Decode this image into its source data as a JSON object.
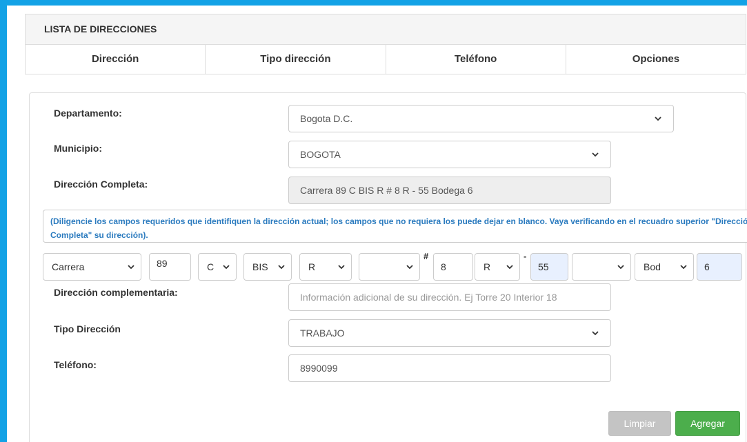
{
  "list": {
    "title": "LISTA DE DIRECCIONES",
    "columns": [
      "Dirección",
      "Tipo dirección",
      "Teléfono",
      "Opciones"
    ]
  },
  "form": {
    "departamento": {
      "label": "Departamento:",
      "value": "Bogota D.C."
    },
    "municipio": {
      "label": "Municipio:",
      "value": "BOGOTA"
    },
    "direccion_completa": {
      "label": "Dirección Completa:",
      "value": "Carrera 89 C BIS R # 8 R - 55 Bodega 6"
    },
    "hint": "(Diligencie los campos requeridos que identifiquen la dirección actual; los campos que no requiera los puede dejar en blanco. Vaya verificando en el recuadro superior \"Dirección Completa\" su dirección).",
    "address_builder": {
      "via_type": "Carrera",
      "via_number": "89",
      "via_letter": "C",
      "bis": "BIS",
      "bis_letter": "R",
      "quadrant": "",
      "hash_symbol": "#",
      "cross_number": "8",
      "cross_letter": "R",
      "dash_symbol": "-",
      "plate_number": "55",
      "cross_quadrant": "",
      "complement_type": "Bod",
      "complement_value": "6"
    },
    "complementaria": {
      "label": "Dirección complementaria:",
      "placeholder": "Información adicional de su dirección. Ej Torre 20 Interior 18"
    },
    "tipo_direccion": {
      "label": "Tipo Dirección",
      "value": "TRABAJO"
    },
    "telefono": {
      "label": "Teléfono:",
      "value": "8990099"
    },
    "buttons": {
      "clear": "Limpiar",
      "add": "Agregar"
    }
  },
  "colors": {
    "frame_border": "#13a2e6",
    "hint_text": "#2b7bbf",
    "add_button": "#4cae4c",
    "clear_button": "#c4c4c4",
    "autofill_bg": "#e8f0fe"
  }
}
